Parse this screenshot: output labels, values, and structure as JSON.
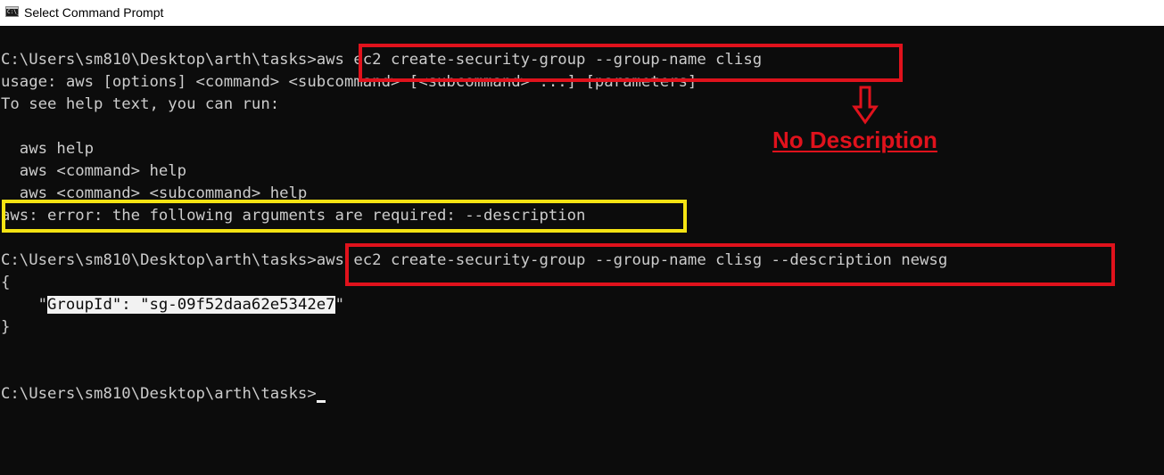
{
  "window": {
    "title": "Select Command Prompt",
    "icon_label": "C:\\_",
    "icon": "cmd-icon"
  },
  "console": {
    "lines": [
      "C:\\Users\\sm810\\Desktop\\arth\\tasks>aws ec2 create-security-group --group-name clisg",
      "usage: aws [options] <command> <subcommand> [<subcommand> ...] [parameters]",
      "To see help text, you can run:",
      "",
      "  aws help",
      "  aws <command> help",
      "  aws <command> <subcommand> help",
      "aws: error: the following arguments are required: --description",
      "",
      "C:\\Users\\sm810\\Desktop\\arth\\tasks>aws ec2 create-security-group --group-name clisg --description newsg",
      "{",
      "    \"GroupId\": \"sg-09f52daa62e5342e7\"",
      "}",
      "",
      "",
      "C:\\Users\\sm810\\Desktop\\arth\\tasks>"
    ],
    "json_line": {
      "indent": "    \"",
      "highlighted": "GroupId\": \"sg-09f52daa62e5342e7",
      "tail": "\""
    }
  },
  "annotations": {
    "label": "No Description",
    "arrow": "down-arrow-icon",
    "colors": {
      "red": "#e0121c",
      "yellow": "#f5e313"
    }
  },
  "colors": {
    "console_bg": "#0c0c0c",
    "console_fg": "#cccccc",
    "titlebar_bg": "#ffffff"
  }
}
